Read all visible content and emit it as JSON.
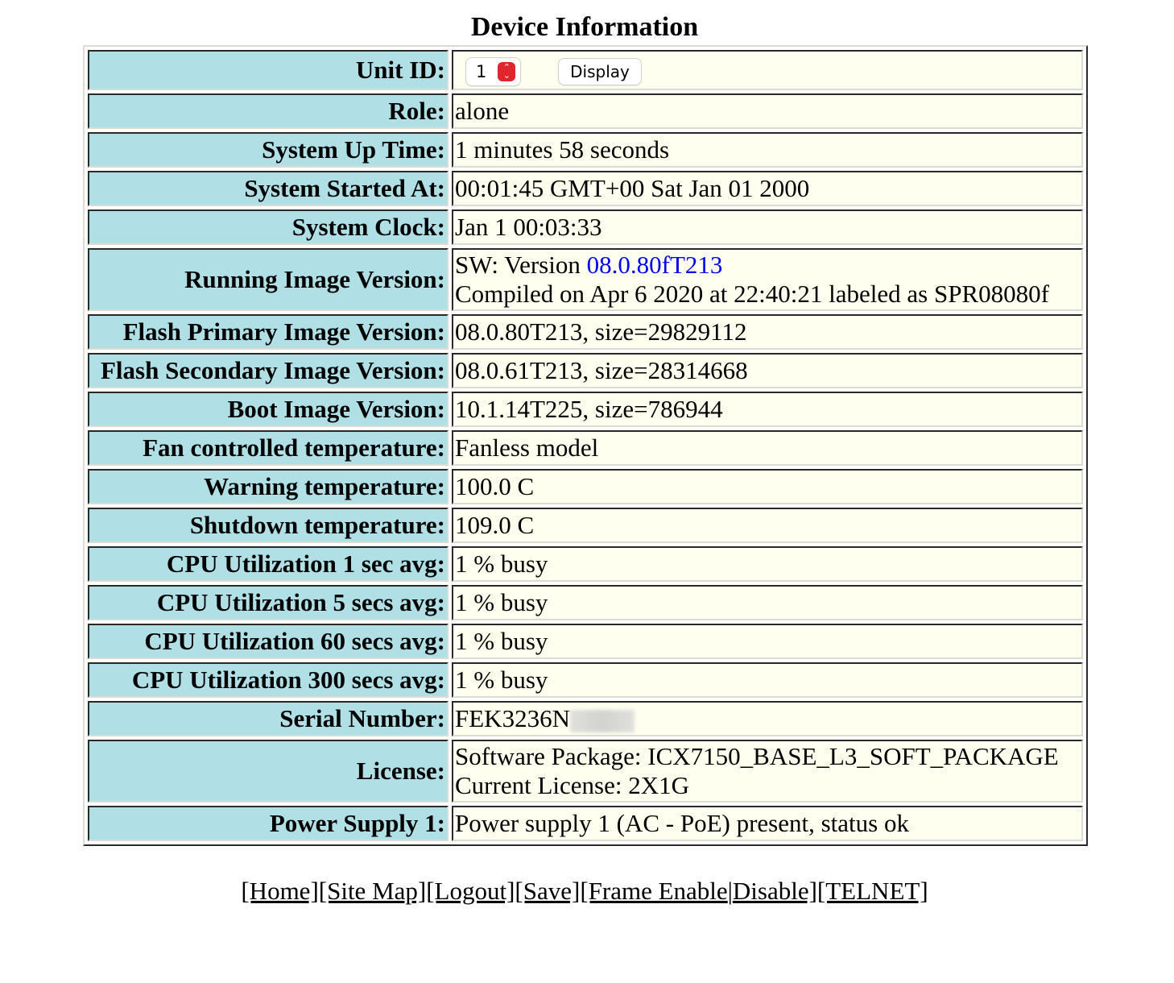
{
  "page": {
    "title": "Device Information"
  },
  "unit": {
    "label": "Unit ID:",
    "selected": "1",
    "display_button": "Display"
  },
  "rows": {
    "role": {
      "label": "Role:",
      "value": "alone"
    },
    "uptime": {
      "label": "System Up Time:",
      "value": "1 minutes 58 seconds"
    },
    "started": {
      "label": "System Started At:",
      "value": "00:01:45 GMT+00 Sat Jan 01 2000"
    },
    "clock": {
      "label": "System Clock:",
      "value": "Jan 1 00:03:33"
    },
    "running": {
      "label": "Running Image Version:",
      "prefix": "SW: Version ",
      "version_link": "08.0.80fT213",
      "line2": "Compiled on Apr 6 2020 at 22:40:21 labeled as SPR08080f"
    },
    "flash_primary": {
      "label": "Flash Primary Image Version:",
      "value": "08.0.80T213, size=29829112"
    },
    "flash_secondary": {
      "label": "Flash Secondary Image Version:",
      "value": "08.0.61T213, size=28314668"
    },
    "boot": {
      "label": "Boot Image Version:",
      "value": "10.1.14T225, size=786944"
    },
    "fan": {
      "label": "Fan controlled temperature:",
      "value": "Fanless model"
    },
    "warning": {
      "label": "Warning temperature:",
      "value": "100.0 C"
    },
    "shutdown": {
      "label": "Shutdown temperature:",
      "value": "109.0 C"
    },
    "cpu1": {
      "label": "CPU Utilization 1 sec avg:",
      "value": "1 % busy"
    },
    "cpu5": {
      "label": "CPU Utilization 5 secs avg:",
      "value": "1 % busy"
    },
    "cpu60": {
      "label": "CPU Utilization 60 secs avg:",
      "value": "1 % busy"
    },
    "cpu300": {
      "label": "CPU Utilization 300 secs avg:",
      "value": "1 % busy"
    },
    "serial": {
      "label": "Serial Number:",
      "value": "FEK3236N"
    },
    "license": {
      "label": "License:",
      "line1": "Software Package: ICX7150_BASE_L3_SOFT_PACKAGE",
      "line2": "Current License: 2X1G"
    },
    "power": {
      "label": "Power Supply 1:",
      "value": "Power supply 1 (AC - PoE) present, status ok"
    }
  },
  "footer": {
    "home": "[Home]",
    "sitemap": "[Site Map]",
    "logout": "[Logout]",
    "save": "[Save]",
    "frame_enable": "[Frame Enable",
    "separator": "|",
    "frame_disable": "Disable]",
    "telnet": "[TELNET]"
  }
}
